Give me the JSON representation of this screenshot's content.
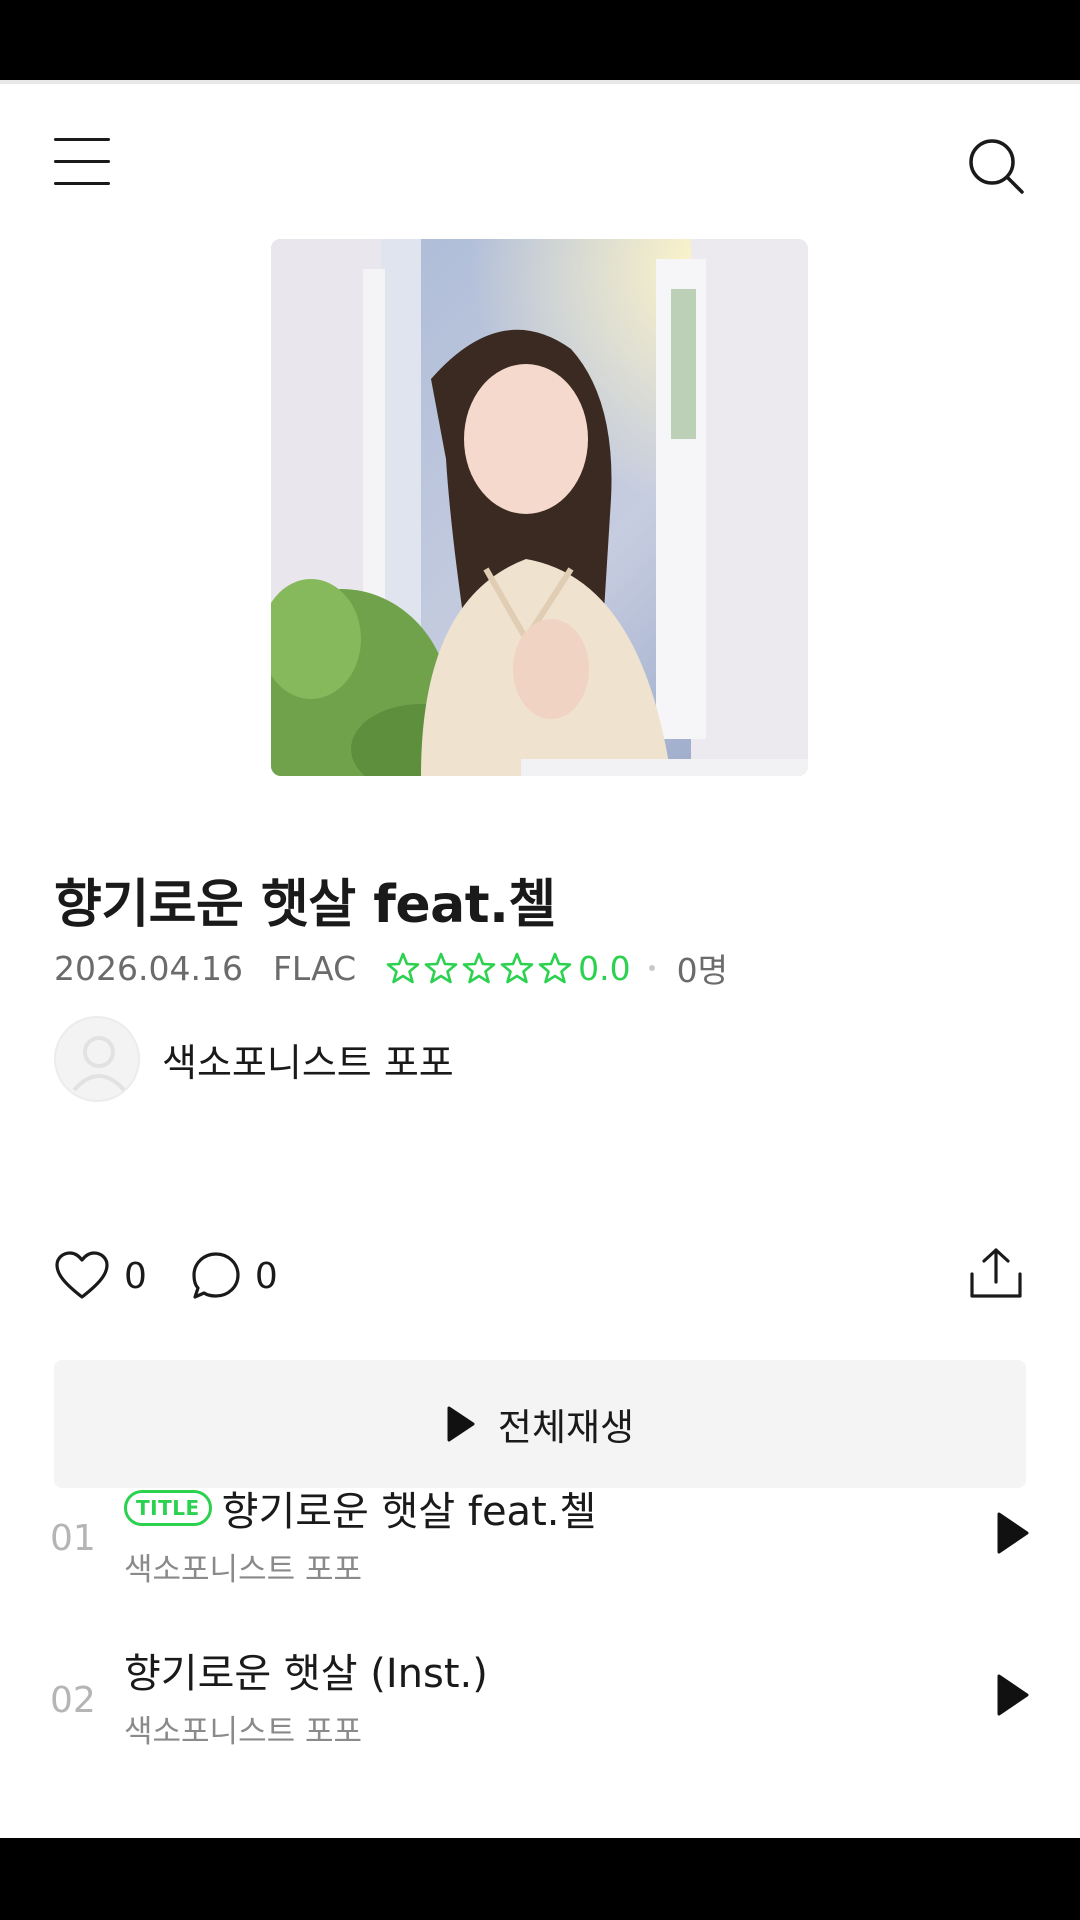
{
  "album": {
    "title": "향기로운 햇살 feat.첼",
    "date": "2026.04.16",
    "format": "FLAC",
    "rating": "0.0",
    "rating_stars": 0,
    "rating_count": "0명",
    "artist": "색소포니스트 포포",
    "likes": "0",
    "comments": "0"
  },
  "play_all_label": "전체재생",
  "tracks": [
    {
      "num": "01",
      "badge": "TITLE",
      "title": "향기로운 햇살 feat.첼",
      "artist": "색소포니스트 포포"
    },
    {
      "num": "02",
      "title": "향기로운 햇살 (Inst.)",
      "artist": "색소포니스트 포포"
    }
  ],
  "icons": {
    "menu": "menu-icon",
    "search": "search-icon",
    "heart": "heart-icon",
    "comment": "comment-icon",
    "share": "share-icon",
    "play": "play-icon",
    "star": "star-outline-icon"
  },
  "colors": {
    "accent": "#2bd14f",
    "text": "#1a1a1a",
    "muted": "#8a8a8a",
    "button_bg": "#f4f4f4"
  }
}
